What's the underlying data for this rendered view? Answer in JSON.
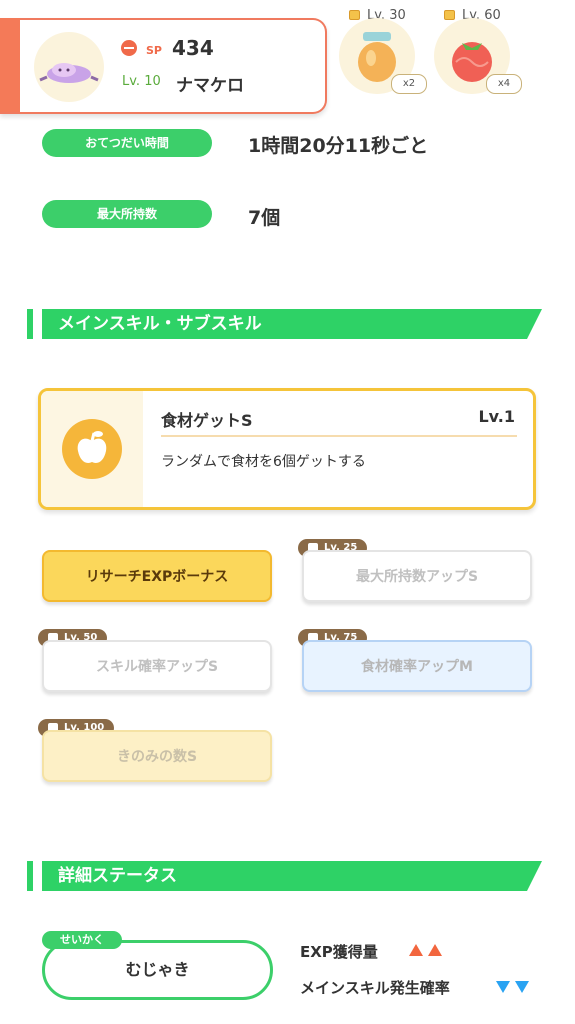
{
  "header": {
    "sp_label": "SP",
    "sp_value": "434",
    "level": "Lv. 10",
    "name": "ナマケロ"
  },
  "items": [
    {
      "level": "Lv. 30",
      "count": "x2",
      "icon": "honey-jar-icon"
    },
    {
      "level": "Lv. 60",
      "count": "x4",
      "icon": "tomato-icon"
    }
  ],
  "stats": [
    {
      "label": "おてつだい時間",
      "value": "1時間20分11秒ごと"
    },
    {
      "label": "最大所持数",
      "value": "7個"
    }
  ],
  "skills_section": {
    "title": "メインスキル・サブスキル"
  },
  "main_skill": {
    "name": "食材ゲットS",
    "level": "Lv.1",
    "description": "ランダムで食材を6個ゲットする",
    "icon": "apple-icon"
  },
  "sub_skills": [
    {
      "label": "リサーチEXPボーナス",
      "lock": ""
    },
    {
      "label": "最大所持数アップS",
      "lock": "Lv. 25"
    },
    {
      "label": "スキル確率アップS",
      "lock": "Lv. 50"
    },
    {
      "label": "食材確率アップM",
      "lock": "Lv. 75"
    },
    {
      "label": "きのみの数S",
      "lock": "Lv. 100"
    }
  ],
  "details_section": {
    "title": "詳細ステータス"
  },
  "nature": {
    "tag": "せいかく",
    "value": "むじゃき"
  },
  "effects": [
    {
      "label": "EXP獲得量",
      "direction": "up",
      "color": "#f2663e"
    },
    {
      "label": "メインスキル発生確率",
      "direction": "down",
      "color": "#2aa3f2"
    }
  ],
  "colors": {
    "accent": "#2ed266",
    "header_stripe": "#f47a58",
    "skill_border": "#f5c43a"
  }
}
